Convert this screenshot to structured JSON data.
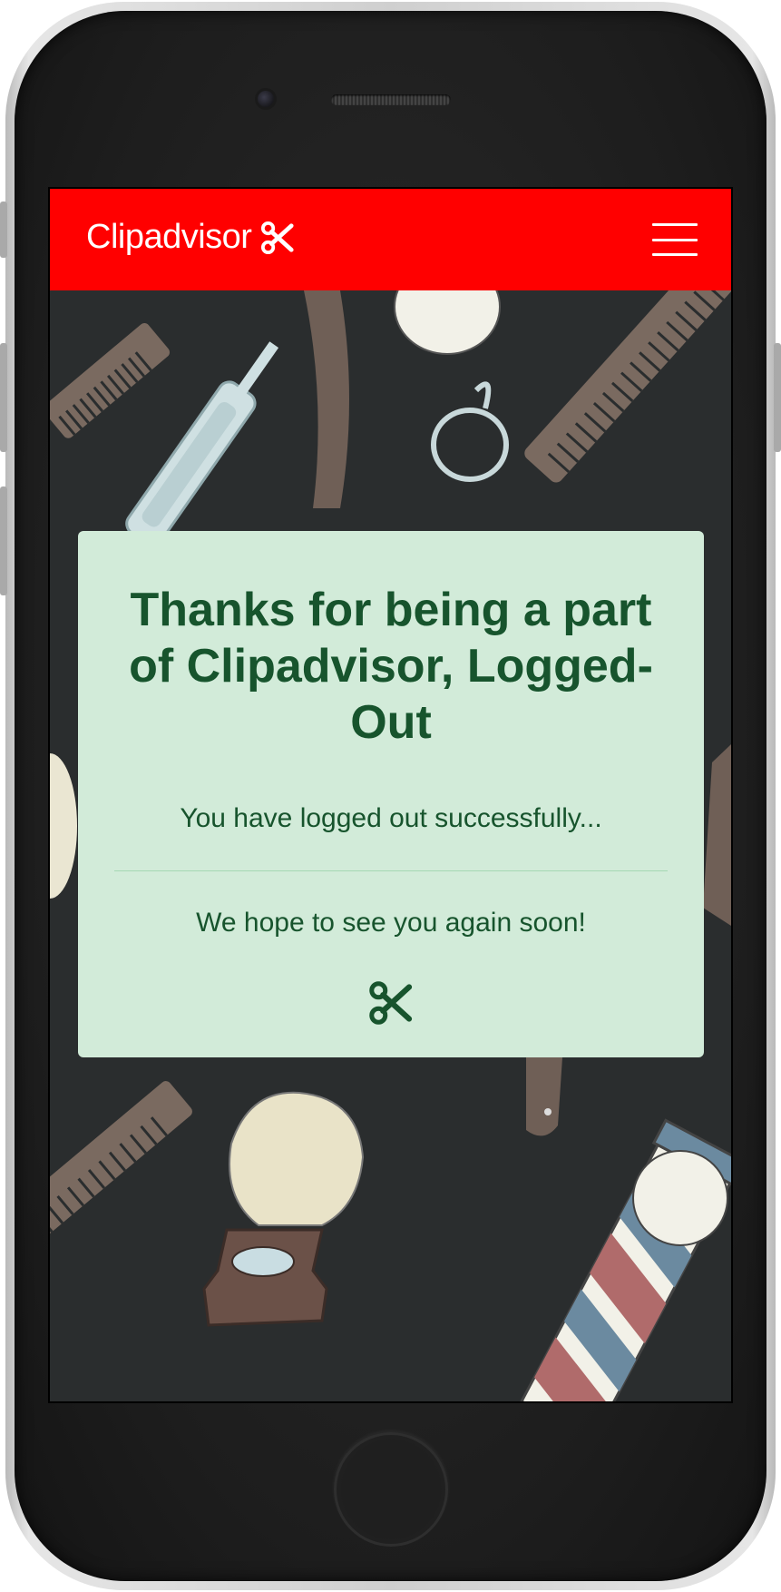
{
  "navbar": {
    "brand": "Clipadvisor",
    "brand_icon": "scissors-icon",
    "menu_icon": "hamburger-menu-icon",
    "background_color": "#ff0000"
  },
  "card": {
    "heading": "Thanks for being a part of Clipadvisor, Logged-Out",
    "message": "You have logged out successfully...",
    "farewell": "We hope to see you again soon!",
    "icon": "scissors-icon",
    "background_color": "#d2ebd9",
    "text_color": "#17542d"
  },
  "background": {
    "illustration": "barber-tools-pattern",
    "color": "#2a2d2e"
  }
}
